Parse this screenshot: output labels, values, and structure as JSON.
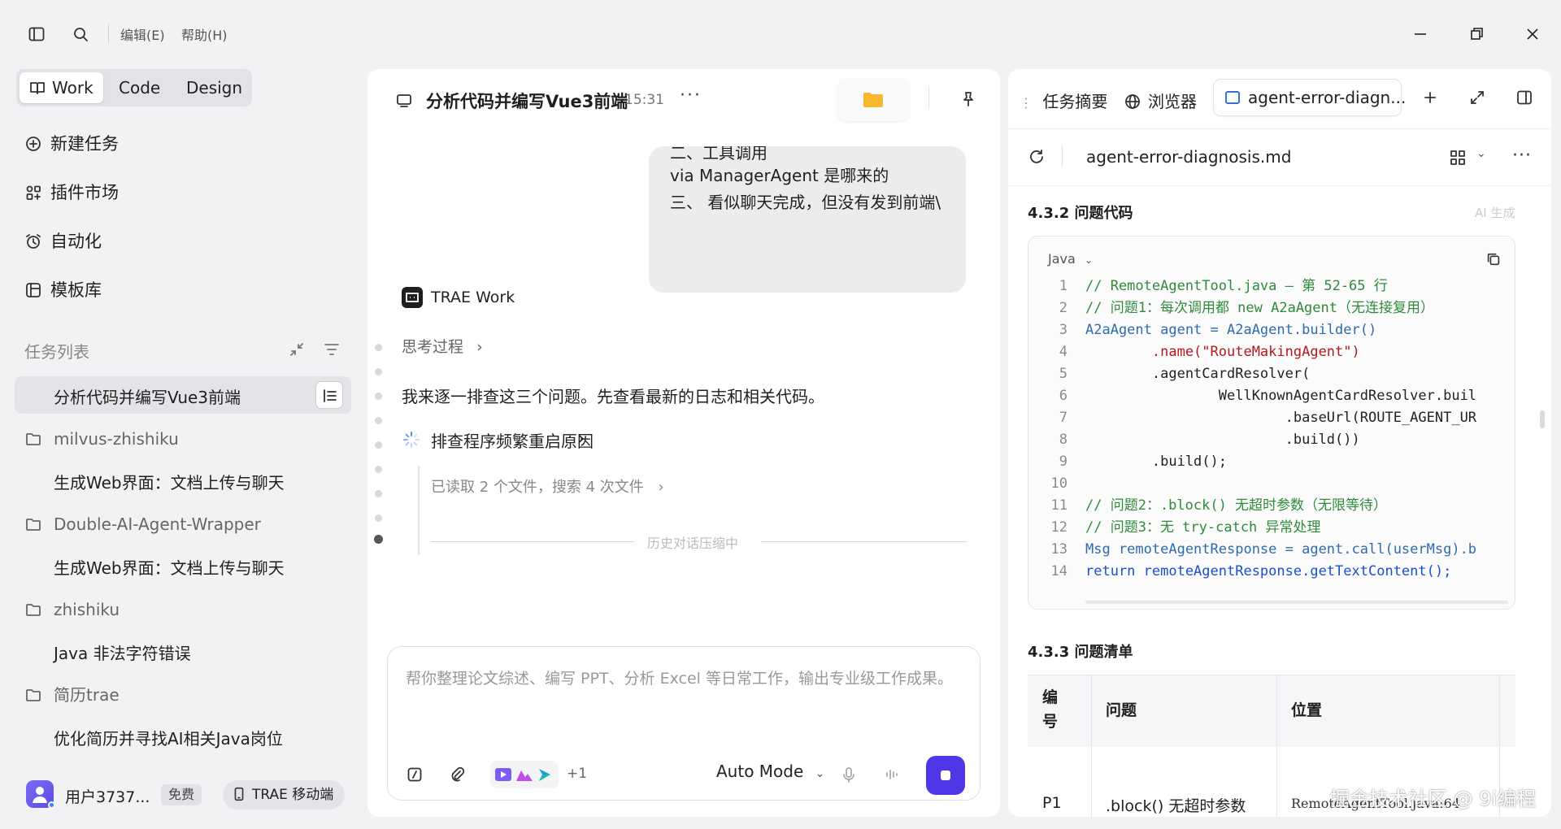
{
  "menubar": {
    "edit": "编辑(E)",
    "help": "帮助(H)"
  },
  "mode_switch": {
    "work": "Work",
    "code": "Code",
    "design": "Design"
  },
  "nav": {
    "new_task": "新建任务",
    "plugin_market": "插件市场",
    "automation": "自动化",
    "templates": "模板库"
  },
  "task_list": {
    "title": "任务列表",
    "selected_task": "分析代码并编写Vue3前端",
    "groups": [
      {
        "folder": "milvus-zhishiku",
        "task": "生成Web界面：文档上传与聊天"
      },
      {
        "folder": "Double-AI-Agent-Wrapper",
        "task": "生成Web界面：文档上传与聊天"
      },
      {
        "folder": "zhishiku",
        "task": "Java 非法字符错误"
      },
      {
        "folder": "简历trae",
        "task": "优化简历并寻找AI相关Java岗位"
      }
    ]
  },
  "user": {
    "name": "用户3737...",
    "plan": "免费",
    "mobile": "TRAE 移动端"
  },
  "chat": {
    "title": "分析代码并编写Vue3前端",
    "time": "15:31",
    "bubble_lines": [
      "二、工具调用",
      "via ManagerAgent  是哪来的",
      "三、 看似聊天完成，但没有发到前端\\"
    ],
    "agent_name": "TRAE Work",
    "thinking": "思考过程",
    "reply": "我来逐一排查这三个问题。先查看最新的日志和相关代码。",
    "step_title": "排查程序频繁重启原因",
    "step_detail": "已读取 2 个文件，搜索 4 次文件",
    "compressing": "历史对话压缩中",
    "input_placeholder": "帮你整理论文综述、编写 PPT、分析 Excel 等日常工作，输出专业级工作成果。",
    "extra_count": "+1",
    "mode": "Auto Mode"
  },
  "right_panel": {
    "tabs": {
      "summary": "任务摘要",
      "browser": "浏览器",
      "file": "agent-error-diagn..."
    },
    "filename": "agent-error-diagnosis.md",
    "ai_badge": "AI 生成",
    "section1": "4.3.2 问题代码",
    "code_lang": "Java",
    "code_lines": [
      {
        "n": "1",
        "text": "// RemoteAgentTool.java — 第 52-65 行"
      },
      {
        "n": "2",
        "text": "// 问题1：每次调用都 new A2aAgent（无连接复用）"
      },
      {
        "n": "3",
        "text": "A2aAgent agent = A2aAgent.builder()"
      },
      {
        "n": "4",
        "text": "        .name(\"RouteMakingAgent\")"
      },
      {
        "n": "5",
        "text": "        .agentCardResolver("
      },
      {
        "n": "6",
        "text": "                WellKnownAgentCardResolver.buil"
      },
      {
        "n": "7",
        "text": "                        .baseUrl(ROUTE_AGENT_UR"
      },
      {
        "n": "8",
        "text": "                        .build())"
      },
      {
        "n": "9",
        "text": "        .build();"
      },
      {
        "n": "10",
        "text": ""
      },
      {
        "n": "11",
        "text": "// 问题2：.block() 无超时参数（无限等待）"
      },
      {
        "n": "12",
        "text": "// 问题3：无 try-catch 异常处理"
      },
      {
        "n": "13",
        "text": "Msg remoteAgentResponse = agent.call(userMsg).b"
      },
      {
        "n": "14",
        "text": "return remoteAgentResponse.getTextContent();"
      }
    ],
    "section2": "4.3.3 问题清单",
    "table_headers": [
      "编号",
      "问题",
      "位置"
    ],
    "table_row": [
      "P1",
      ".block() 无超时参数",
      "RemoteAgentTool.java:64"
    ],
    "watermark": "掘金技术社区 @ 9i编程"
  }
}
